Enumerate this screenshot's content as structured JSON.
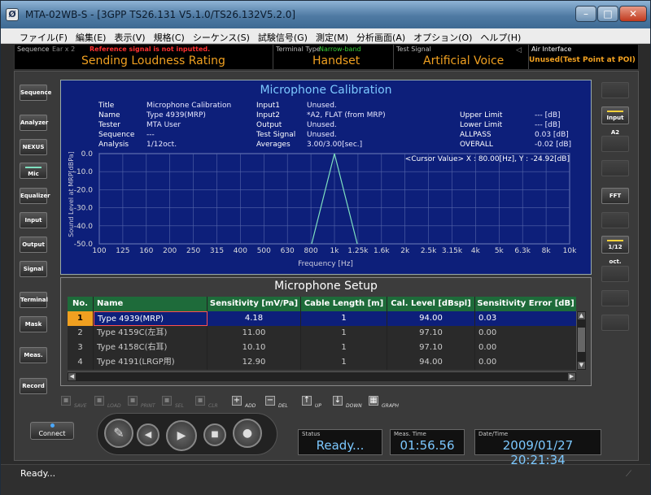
{
  "window": {
    "title": "MTA-02WB-S - [3GPP TS26.131 V5.1.0/TS26.132V5.2.0]",
    "min_glyph": "–",
    "max_glyph": "□",
    "close_glyph": "✕"
  },
  "menu": [
    "ファイル(F)",
    "編集(E)",
    "表示(V)",
    "規格(C)",
    "シーケンス(S)",
    "試験信号(G)",
    "測定(M)",
    "分析画面(A)",
    "オプション(O)",
    "ヘルプ(H)"
  ],
  "strip": {
    "sequence_label": "Sequence",
    "ear_label": "Ear x 2",
    "warning": "Reference signal is not inputted.",
    "sequence_value": "Sending Loudness Rating",
    "terminal_label": "Terminal Type",
    "terminal_band": "Narrow-band",
    "terminal_value": "Handset",
    "signal_label": "Test Signal",
    "signal_value": "Artificial Voice",
    "air_label": "Air Interface",
    "air_value": "Unused(Test Point at POI)"
  },
  "left_buttons": [
    "Sequence",
    "Analyzer",
    "NEXUS",
    "Mic",
    "Equalizer",
    "Input",
    "Output",
    "Signal",
    "Terminal",
    "Mask",
    "Meas.",
    "Record"
  ],
  "right_buttons": {
    "input_a2": "Input A2",
    "fft": "FFT",
    "oct": "1/12 oct."
  },
  "graph": {
    "title": "Microphone Calibration",
    "info": {
      "title_label": "Title",
      "title_value": "Microphone Calibration",
      "name_label": "Name",
      "name_value": "Type 4939(MRP)",
      "tester_label": "Tester",
      "tester_value": "MTA User",
      "sequence_label": "Sequence",
      "sequence_value": "---",
      "analysis_label": "Analysis",
      "analysis_value": "1/12oct.",
      "input1_label": "Input1",
      "input1_value": "Unused.",
      "input2_label": "Input2",
      "input2_value": "*A2, FLAT (from MRP)",
      "output_label": "Output",
      "output_value": "Unused.",
      "signal_label": "Test Signal",
      "signal_value": "Unused.",
      "averages_label": "Averages",
      "averages_value": "3.00/3.00[sec.]",
      "upper_label": "Upper Limit",
      "upper_value": "--- [dB]",
      "lower_label": "Lower Limit",
      "lower_value": "--- [dB]",
      "allpass_label": "ALLPASS",
      "allpass_value": "0.03 [dB]",
      "overall_label": "OVERALL",
      "overall_value": "-0.02 [dB]"
    },
    "cursor": "<Cursor Value> X : 80.00[Hz], Y : -24.92[dB]"
  },
  "chart_data": {
    "type": "line",
    "xlabel": "Frequency [Hz]",
    "ylabel": "Sound Level at MRP[dBPa]",
    "x_ticks": [
      "100",
      "125",
      "160",
      "200",
      "250",
      "315",
      "400",
      "500",
      "630",
      "800",
      "1k",
      "1.25k",
      "1.6k",
      "2k",
      "2.5k",
      "3.15k",
      "4k",
      "5k",
      "6.3k",
      "8k",
      "10k"
    ],
    "y_ticks": [
      "0.0",
      "-10.0",
      "-20.0",
      "-30.0",
      "-40.0",
      "-50.0"
    ],
    "ylim": [
      -50,
      0
    ],
    "x_scale": "log",
    "xlim": [
      100,
      10000
    ],
    "grid": true,
    "series": [
      {
        "color": "#7fe0c0",
        "x": [
          800,
          1000,
          1250
        ],
        "y": [
          -50,
          0,
          -50
        ]
      }
    ]
  },
  "setup": {
    "title": "Microphone Setup",
    "columns": [
      "No.",
      "Name",
      "Sensitivity [mV/Pa]",
      "Cable Length [m]",
      "Cal. Level [dBspl]",
      "Sensitivity Error [dB]"
    ],
    "rows": [
      [
        "1",
        "Type 4939(MRP)",
        "4.18",
        "1",
        "94.00",
        "0.03"
      ],
      [
        "2",
        "Type 4159C(左耳)",
        "11.00",
        "1",
        "97.10",
        "0.00"
      ],
      [
        "3",
        "Type 4158C(右耳)",
        "10.10",
        "1",
        "97.10",
        "0.00"
      ],
      [
        "4",
        "Type 4191(LRGP用)",
        "12.90",
        "1",
        "94.00",
        "0.00"
      ]
    ]
  },
  "toolbar": [
    {
      "label": "SAVE",
      "glyph": "▪"
    },
    {
      "label": "LOAD",
      "glyph": "▪"
    },
    {
      "label": "PRINT",
      "glyph": "▪"
    },
    {
      "label": "SEL",
      "glyph": "▪"
    },
    {
      "label": "CLR",
      "glyph": "▪"
    },
    {
      "label": "ADD",
      "glyph": "+"
    },
    {
      "label": "DEL",
      "glyph": "−"
    },
    {
      "label": "UP",
      "glyph": "↑"
    },
    {
      "label": "DOWN",
      "glyph": "↓"
    },
    {
      "label": "GRAPH",
      "glyph": "▦"
    }
  ],
  "bottom": {
    "connect": "Connect",
    "status_label": "Status",
    "status_value": "Ready...",
    "meas_label": "Meas. Time",
    "meas_value": "01:56.56",
    "date_label": "Date/Time",
    "date_value": "2009/01/27 20:21:34",
    "statusbar": "Ready..."
  }
}
